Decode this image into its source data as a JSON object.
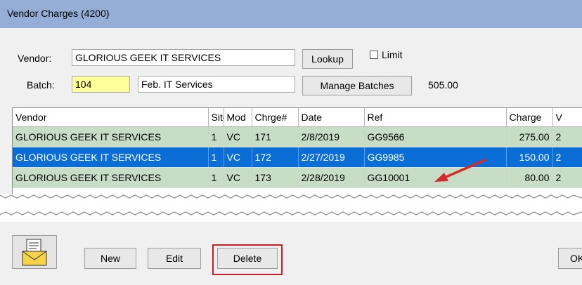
{
  "window": {
    "title": "Vendor Charges (4200)"
  },
  "form": {
    "vendor_label": "Vendor:",
    "vendor_value": "GLORIOUS GEEK IT SERVICES",
    "lookup_label": "Lookup",
    "limit_label": "Limit",
    "batch_label": "Batch:",
    "batch_value": "104",
    "batch_desc": "Feb. IT Services",
    "manage_batches_label": "Manage Batches",
    "batch_total": "505.00"
  },
  "grid": {
    "columns": [
      "Vendor",
      "Site",
      "Mod",
      "Chrge#",
      "Date",
      "Ref",
      "Charge",
      "V"
    ],
    "rows": [
      {
        "vendor": "GLORIOUS GEEK IT SERVICES",
        "site": "1",
        "mod": "VC",
        "chrge": "171",
        "date": "2/8/2019",
        "ref": "GG9566",
        "charge": "275.00",
        "v": "2"
      },
      {
        "vendor": "GLORIOUS GEEK IT SERVICES",
        "site": "1",
        "mod": "VC",
        "chrge": "172",
        "date": "2/27/2019",
        "ref": "GG9985",
        "charge": "150.00",
        "v": "2"
      },
      {
        "vendor": "GLORIOUS GEEK IT SERVICES",
        "site": "1",
        "mod": "VC",
        "chrge": "173",
        "date": "2/28/2019",
        "ref": "GG10001",
        "charge": "80.00",
        "v": "2"
      }
    ],
    "selected_row": 1
  },
  "buttons": {
    "new_label": "New",
    "edit_label": "Edit",
    "delete_label": "Delete",
    "ok_label": "OK"
  },
  "colors": {
    "titlebar": "#95aed6",
    "row_normal": "#c8ddc6",
    "row_selected": "#0a6ed6",
    "highlight_box": "#c81e28",
    "arrow": "#d42b2b"
  },
  "icons": {
    "mail_icon": "envelope-with-document-icon",
    "arrow": "red-pointer-arrow"
  }
}
